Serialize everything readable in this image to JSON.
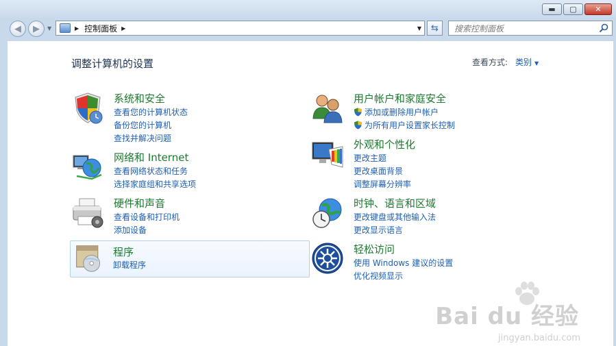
{
  "window": {
    "minimize_glyph": "▬",
    "maximize_glyph": "▢",
    "close_glyph": "✕"
  },
  "nav": {
    "address_crumb": "控制面板",
    "search_placeholder": "搜索控制面板"
  },
  "page": {
    "heading": "调整计算机的设置",
    "view_by_label": "查看方式:",
    "view_by_value": "类别"
  },
  "categories": {
    "system_security": {
      "title": "系统和安全",
      "icon": "shield-icon",
      "links": [
        "查看您的计算机状态",
        "备份您的计算机",
        "查找并解决问题"
      ]
    },
    "network_internet": {
      "title": "网络和 Internet",
      "icon": "network-globe-icon",
      "links": [
        "查看网络状态和任务",
        "选择家庭组和共享选项"
      ]
    },
    "hardware_sound": {
      "title": "硬件和声音",
      "icon": "printer-icon",
      "links": [
        "查看设备和打印机",
        "添加设备"
      ]
    },
    "programs": {
      "title": "程序",
      "icon": "programs-disc-icon",
      "links": [
        "卸载程序"
      ]
    },
    "user_accounts": {
      "title": "用户帐户和家庭安全",
      "icon": "users-icon",
      "links": [
        "添加或删除用户帐户",
        "为所有用户设置家长控制"
      ]
    },
    "appearance": {
      "title": "外观和个性化",
      "icon": "monitor-palette-icon",
      "links": [
        "更改主题",
        "更改桌面背景",
        "调整屏幕分辨率"
      ]
    },
    "clock_language": {
      "title": "时钟、语言和区域",
      "icon": "clock-globe-icon",
      "links": [
        "更改键盘或其他输入法",
        "更改显示语言"
      ]
    },
    "ease_of_access": {
      "title": "轻松访问",
      "icon": "ease-of-access-icon",
      "links": [
        "使用 Windows 建议的设置",
        "优化视频显示"
      ]
    }
  },
  "watermark": {
    "brand": "Bai du 经验",
    "url": "jingyan.baidu.com"
  },
  "colors": {
    "category_title": "#1c7a2e",
    "link": "#1e5fb3",
    "heading": "#1e3252"
  }
}
